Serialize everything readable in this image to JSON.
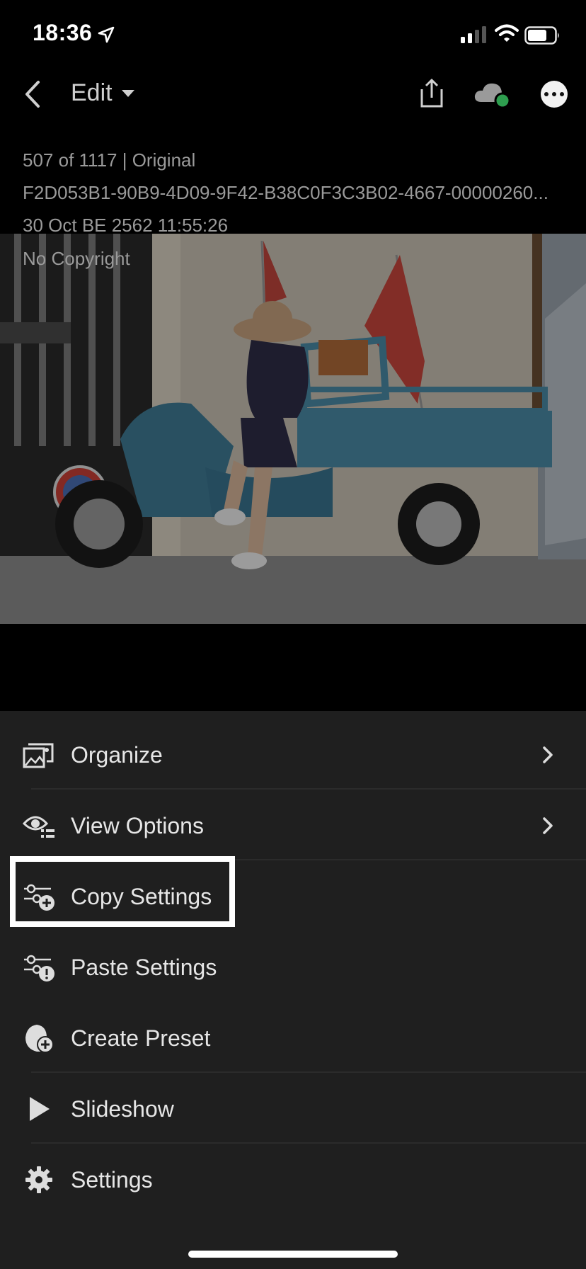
{
  "status_bar": {
    "time": "18:36",
    "icons": [
      "location-arrow-icon",
      "cellular-signal-icon",
      "wifi-icon",
      "battery-icon"
    ]
  },
  "nav": {
    "back_icon": "chevron-left-icon",
    "edit_label": "Edit",
    "edit_dropdown_icon": "caret-down-icon",
    "share_icon": "share-icon",
    "cloud_icon": "cloud-sync-icon",
    "more_icon": "more-options-icon"
  },
  "info": {
    "position": "507 of 1117 | Original",
    "filename": "F2D053B1-90B9-4D09-9F42-B38C0F3C3B02-4667-00000260...",
    "date": "30 Oct BE 2562 11:55:26",
    "copyright": "No Copyright"
  },
  "photo": {
    "description_icon": "photo"
  },
  "menu": {
    "items": [
      {
        "label": "Organize",
        "icon": "organize-icon",
        "has_chevron": true
      },
      {
        "label": "View Options",
        "icon": "view-options-icon",
        "has_chevron": true
      },
      {
        "label": "Copy Settings",
        "icon": "copy-settings-icon",
        "has_chevron": false,
        "highlighted": true
      },
      {
        "label": "Paste Settings",
        "icon": "paste-settings-icon",
        "has_chevron": false
      },
      {
        "label": "Create Preset",
        "icon": "create-preset-icon",
        "has_chevron": false
      },
      {
        "label": "Slideshow",
        "icon": "play-icon",
        "has_chevron": false
      },
      {
        "label": "Settings",
        "icon": "gear-icon",
        "has_chevron": false
      }
    ]
  },
  "colors": {
    "sheet_bg": "#1f1f1f",
    "cloud_status": "#2e9e4f",
    "highlight_border": "#ffffff"
  }
}
